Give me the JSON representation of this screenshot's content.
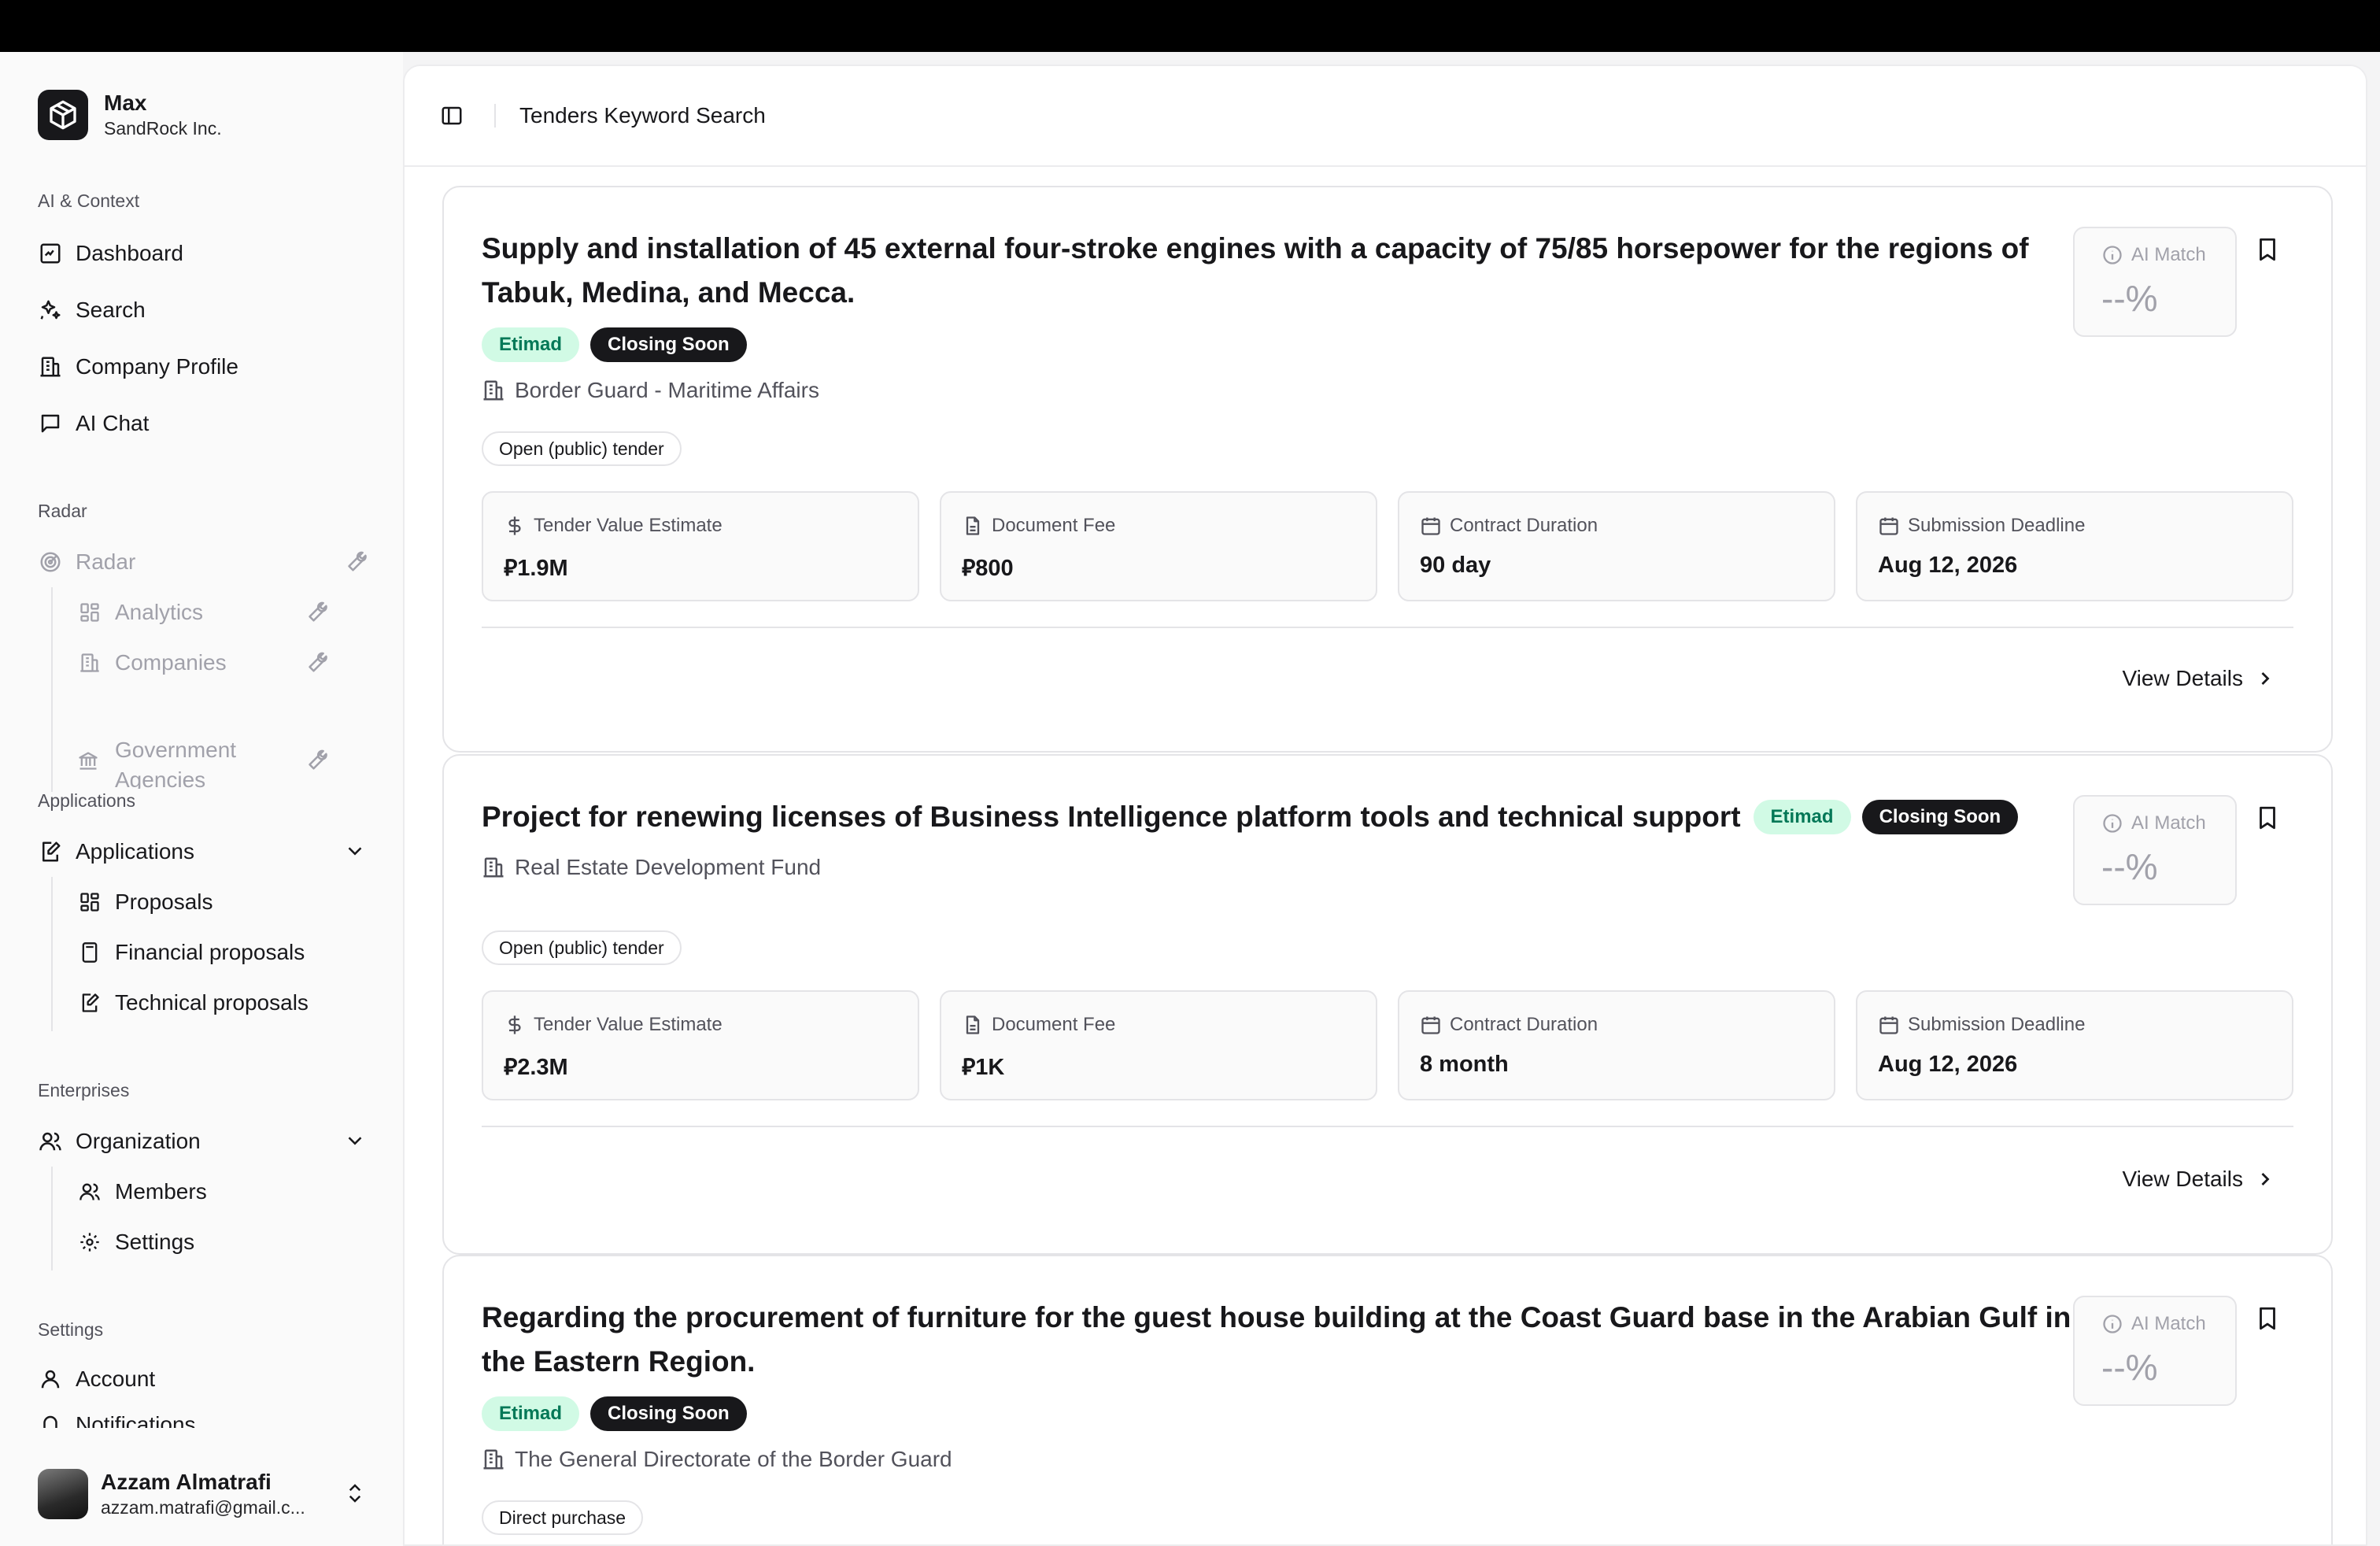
{
  "sidebar": {
    "brand": {
      "name": "Max",
      "org": "SandRock Inc."
    },
    "groups": {
      "ai_context": "AI & Context",
      "radar": "Radar",
      "applications": "Applications",
      "enterprises": "Enterprises",
      "settings": "Settings"
    },
    "items": {
      "dashboard": "Dashboard",
      "search": "Search",
      "company_profile": "Company Profile",
      "ai_chat": "AI Chat",
      "radar": "Radar",
      "analytics": "Analytics",
      "companies": "Companies",
      "government_agencies": "Government Agencies",
      "applications": "Applications",
      "proposals": "Proposals",
      "financial_proposals": "Financial proposals",
      "technical_proposals": "Technical proposals",
      "organization": "Organization",
      "members": "Members",
      "settings": "Settings",
      "account": "Account",
      "notifications": "Notifications"
    },
    "user": {
      "name": "Azzam Almatrafi",
      "email": "azzam.matrafi@gmail.c..."
    }
  },
  "header": {
    "breadcrumb": "Tenders Keyword Search"
  },
  "labels": {
    "ai_match": "AI Match",
    "tender_value": "Tender Value Estimate",
    "document_fee": "Document Fee",
    "contract_duration": "Contract Duration",
    "submission_deadline": "Submission Deadline",
    "view_details": "View Details"
  },
  "tenders": [
    {
      "title": "Supply and installation of 45 external four-stroke engines with a capacity of 75/85 horsepower for the regions of Tabuk, Medina, and Mecca.",
      "source": "Etimad",
      "status": "Closing Soon",
      "agency": "Border Guard - Maritime Affairs",
      "type": "Open (public) tender",
      "ai_match": "--%",
      "tender_value": "1.9M",
      "document_fee": "800",
      "contract_duration": "90 day",
      "submission_deadline": "Aug 12, 2026"
    },
    {
      "title": "Project for renewing licenses of Business Intelligence platform tools and technical support",
      "source": "Etimad",
      "status": "Closing Soon",
      "agency": "Real Estate Development Fund",
      "type": "Open (public) tender",
      "ai_match": "--%",
      "tender_value": "2.3M",
      "document_fee": "1K",
      "contract_duration": "8 month",
      "submission_deadline": "Aug 12, 2026"
    },
    {
      "title": "Regarding the procurement of furniture for the guest house building at the Coast Guard base in the Arabian Gulf in the Eastern Region.",
      "source": "Etimad",
      "status": "Closing Soon",
      "agency": "The General Directorate of the Border Guard",
      "type": "Direct purchase",
      "ai_match": "--%"
    }
  ],
  "colors": {
    "accent": "#18181b",
    "etimad_bg": "#d1fae5",
    "etimad_text": "#047857"
  }
}
